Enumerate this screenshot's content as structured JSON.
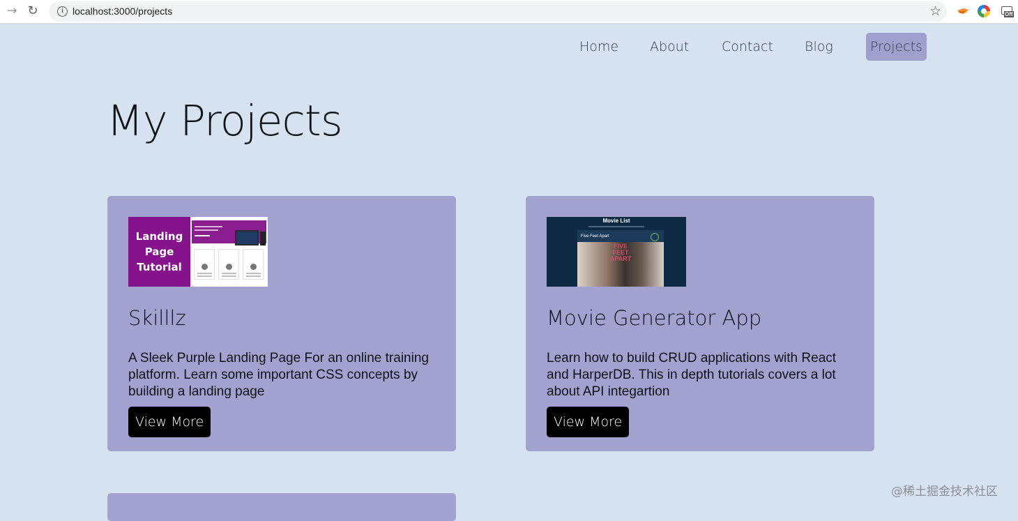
{
  "browser": {
    "url": "localhost:3000/projects"
  },
  "nav": {
    "items": [
      {
        "label": "Home"
      },
      {
        "label": "About"
      },
      {
        "label": "Contact"
      },
      {
        "label": "Blog"
      },
      {
        "label": "Projects",
        "active": true
      }
    ],
    "active_color": "#a0a0cf"
  },
  "page": {
    "title": "My Projects",
    "background": "#d6e2ef"
  },
  "projects": [
    {
      "title": "Skilllz",
      "description": "A Sleek Purple Landing Page For an online training platform. Learn some important CSS concepts by building a landing page",
      "button": "View More",
      "thumbnail_text": [
        "Landing",
        "Page",
        "Tutorial"
      ]
    },
    {
      "title": "Movie Generator App",
      "description": "Learn how to build CRUD applications with React and HarperDB. This in depth tutorials covers a lot about API integartion",
      "button": "View More",
      "thumbnail_title": "Movie List",
      "thumbnail_movie": "Five Feet Apart",
      "thumbnail_poster": [
        "FIVE",
        "FEET",
        "APART"
      ]
    }
  ],
  "card_color": "#a2a1cf",
  "watermark": "@稀土掘金技术社区"
}
